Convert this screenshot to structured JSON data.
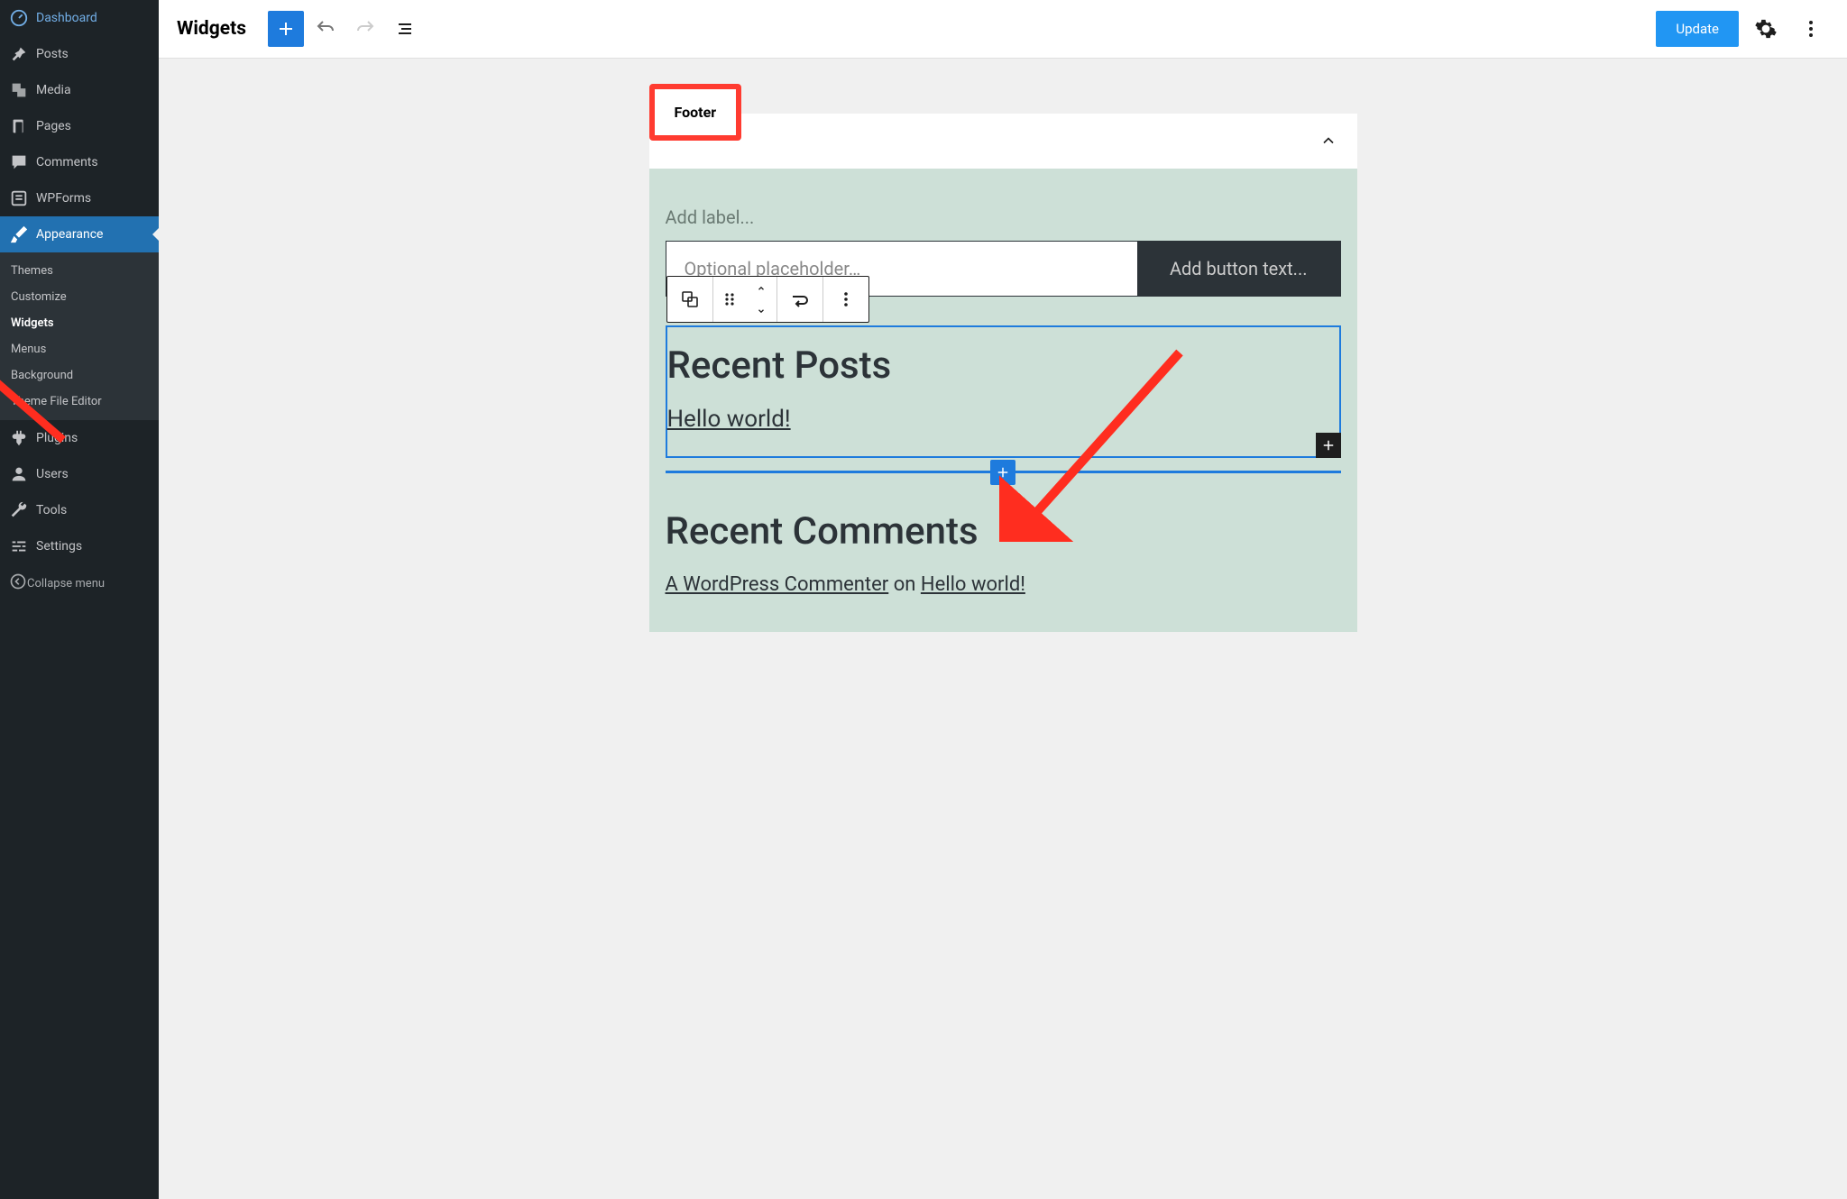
{
  "sidebar": {
    "items": [
      {
        "icon": "dashboard",
        "label": "Dashboard"
      },
      {
        "icon": "pin",
        "label": "Posts"
      },
      {
        "icon": "media",
        "label": "Media"
      },
      {
        "icon": "page",
        "label": "Pages"
      },
      {
        "icon": "comment",
        "label": "Comments"
      },
      {
        "icon": "form",
        "label": "WPForms"
      }
    ],
    "appearance": {
      "label": "Appearance"
    },
    "submenu": [
      {
        "label": "Themes"
      },
      {
        "label": "Customize"
      },
      {
        "label": "Widgets",
        "current": true
      },
      {
        "label": "Menus"
      },
      {
        "label": "Background"
      },
      {
        "label": "Theme File Editor"
      }
    ],
    "items2": [
      {
        "icon": "plugin",
        "label": "Plugins"
      },
      {
        "icon": "user",
        "label": "Users"
      },
      {
        "icon": "tool",
        "label": "Tools"
      },
      {
        "icon": "settings",
        "label": "Settings"
      }
    ],
    "collapse": "Collapse menu"
  },
  "toolbar": {
    "title": "Widgets",
    "update": "Update"
  },
  "area": {
    "title": "Footer",
    "label_placeholder": "Add label...",
    "input_placeholder": "Optional placeholder…",
    "button_placeholder": "Add button text..."
  },
  "recent_posts": {
    "heading": "Recent Posts",
    "items": [
      "Hello world!"
    ]
  },
  "recent_comments": {
    "heading": "Recent Comments",
    "author": "A WordPress Commenter",
    "on": " on ",
    "post": "Hello world!"
  }
}
